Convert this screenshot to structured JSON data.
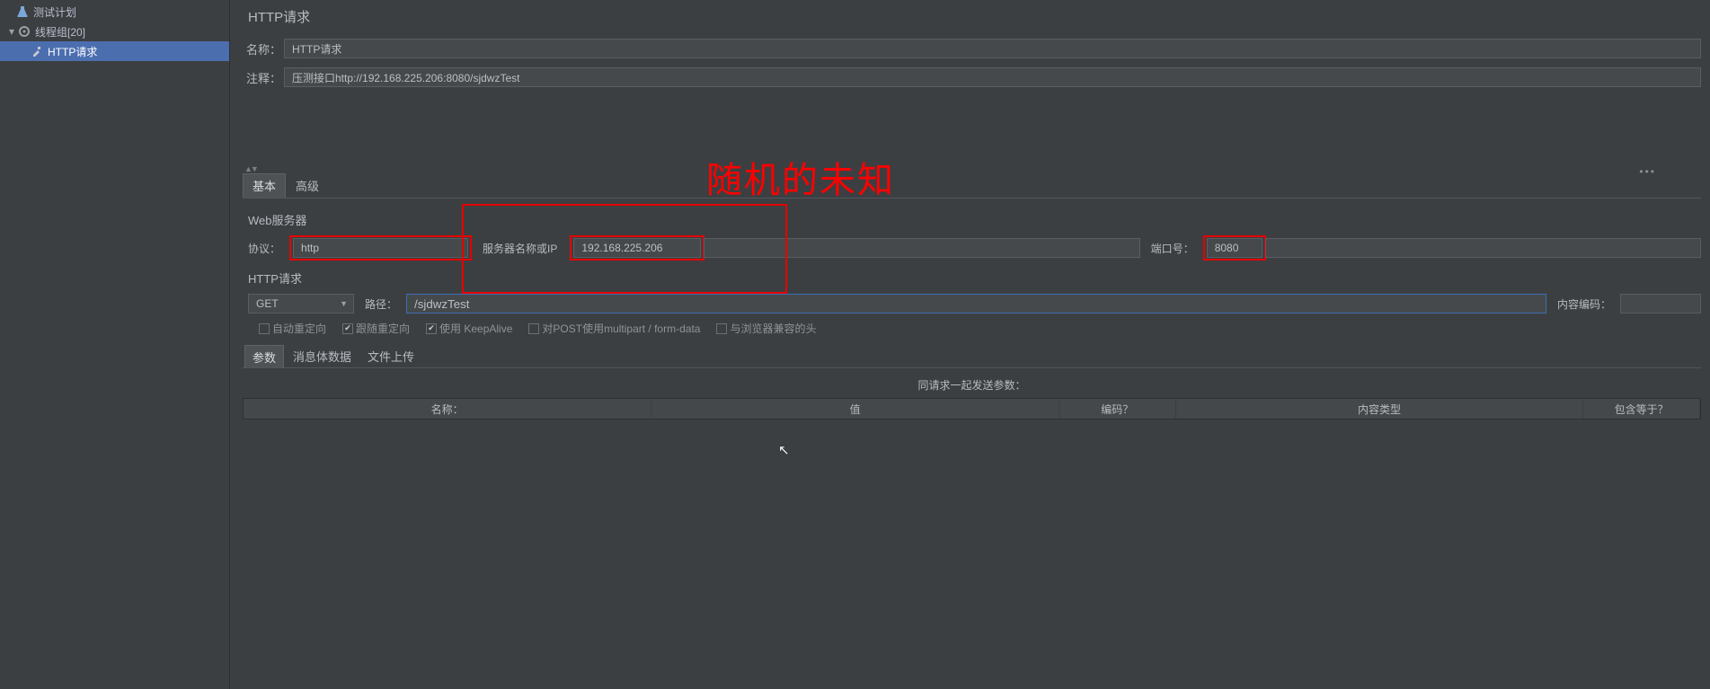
{
  "tree": {
    "test_plan": "测试计划",
    "thread_group": "线程组[20]",
    "http_request": "HTTP请求"
  },
  "header": {
    "title": "HTTP请求"
  },
  "form": {
    "name_label": "名称：",
    "name_value": "HTTP请求",
    "comment_label": "注释：",
    "comment_value": "压测接口http://192.168.225.206:8080/sjdwzTest"
  },
  "annotation": "随机的未知",
  "tabs": {
    "basic": "基本",
    "advanced": "高级"
  },
  "web": {
    "section": "Web服务器",
    "protocol_label": "协议：",
    "protocol_value": "http",
    "server_label": "服务器名称或IP",
    "server_value": "192.168.225.206",
    "port_label": "端口号：",
    "port_value": "8080"
  },
  "req": {
    "section": "HTTP请求",
    "method": "GET",
    "path_label": "路径：",
    "path_value": "/sjdwzTest",
    "enc_label": "内容编码：",
    "enc_value": ""
  },
  "checks": {
    "auto_redirect": "自动重定向",
    "follow_redirect": "跟随重定向",
    "keepalive": "使用 KeepAlive",
    "multipart": "对POST使用multipart / form-data",
    "browser_headers": "与浏览器兼容的头"
  },
  "ptabs": {
    "params": "参数",
    "body": "消息体数据",
    "files": "文件上传"
  },
  "table": {
    "caption": "同请求一起发送参数：",
    "col_name": "名称：",
    "col_value": "值",
    "col_encode": "编码？",
    "col_ctype": "内容类型",
    "col_include": "包含等于？"
  }
}
